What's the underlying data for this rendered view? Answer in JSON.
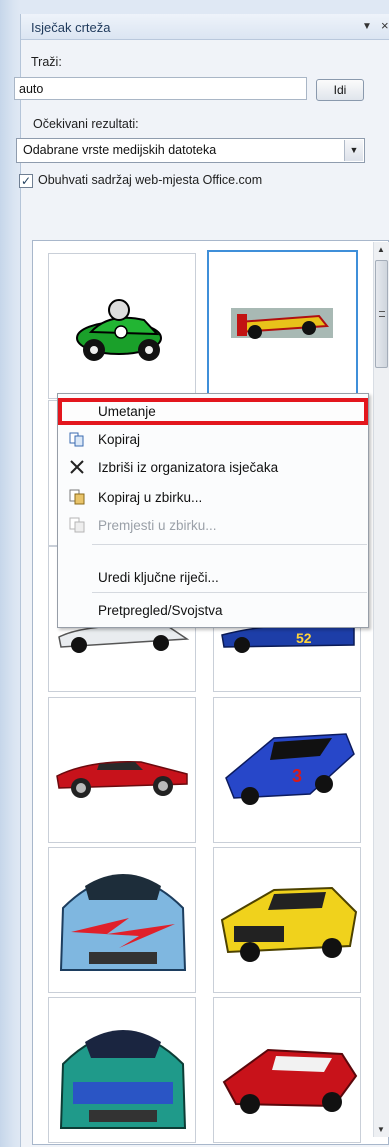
{
  "pane": {
    "title": "Isječak crteža",
    "dropdown_icon": "chevron-down-icon",
    "close_icon": "close-icon"
  },
  "search": {
    "label": "Traži:",
    "value": "auto",
    "go_label": "Idi"
  },
  "results_filter": {
    "label": "Očekivani rezultati:",
    "selected": "Odabrane vrste medijskih datoteka",
    "checkbox_label": "Obuhvati sadržaj web-mjesta Office.com",
    "checkbox_checked": true
  },
  "context_menu": {
    "items": [
      {
        "label": "Umetanje",
        "icon": "insert-icon",
        "enabled": true,
        "highlighted": true
      },
      {
        "label": "Kopiraj",
        "icon": "copy-icon",
        "enabled": true
      },
      {
        "label": "Izbriši iz organizatora isječaka",
        "icon": "delete-x-icon",
        "enabled": true
      },
      {
        "label": "Kopiraj u zbirku...",
        "icon": "copy-to-collection-icon",
        "enabled": true
      },
      {
        "label": "Premjesti u zbirku...",
        "icon": "move-to-collection-icon",
        "enabled": false
      },
      {
        "label": "Uredi ključne riječi...",
        "icon": "",
        "enabled": true
      },
      {
        "label": "Pretpregled/Svojstva",
        "icon": "",
        "enabled": true
      }
    ]
  },
  "clips": [
    {
      "name": "clip-green-cartoon-car"
    },
    {
      "name": "clip-formula-race-car"
    },
    {
      "name": "clip-white-race-car"
    },
    {
      "name": "clip-blue-race-car-52"
    },
    {
      "name": "clip-red-sports-car"
    },
    {
      "name": "clip-blue-nascar"
    },
    {
      "name": "clip-blue-lightning-car-front"
    },
    {
      "name": "clip-yellow-muscle-car"
    },
    {
      "name": "clip-green-blue-race-car-front"
    },
    {
      "name": "clip-red-sports-car-rear"
    }
  ],
  "colors": {
    "highlight_border": "#e3161d",
    "selection_border": "#3f8fd9"
  }
}
